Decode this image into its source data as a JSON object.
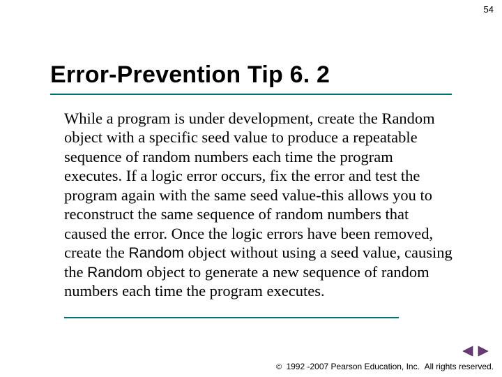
{
  "page_number": "54",
  "title": "Error-Prevention Tip 6. 2",
  "body": {
    "p1": "While a program is under development, create the Random object with a specific seed value to produce a repeatable sequence of random numbers each time the program executes. If a logic error occurs, fix the error and test the program again with the same seed value-this allows you to reconstruct the same sequence of random numbers that caused the error. Once the logic errors have been removed, create the ",
    "code1": "Random",
    "p2": " object without using a seed value, causing the ",
    "code2": "Random",
    "p3": " object to generate a new sequence of random numbers each time the program executes."
  },
  "nav": {
    "prev": "prev-slide",
    "next": "next-slide"
  },
  "footer": {
    "copyright_symbol": "©",
    "years": "1992 -2007",
    "org": "Pearson Education, Inc.",
    "rights": "All rights reserved."
  }
}
